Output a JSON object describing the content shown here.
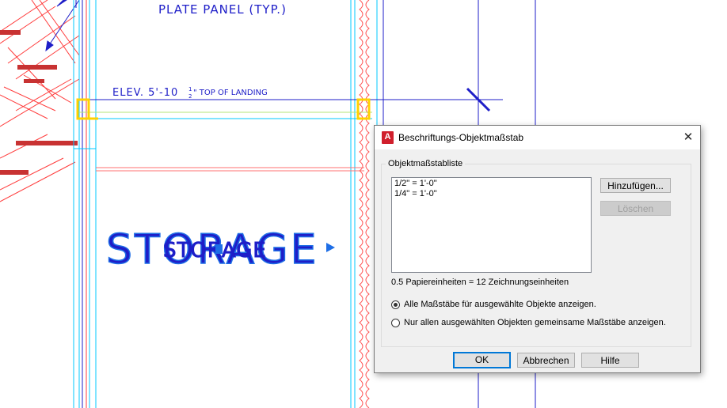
{
  "drawing": {
    "plate_panel_label": "PLATE PANEL (TYP.)",
    "elev_label": "ELEV. 5'-10",
    "elev_fraction_num": "1",
    "elev_fraction_den": "2",
    "elev_suffix": "\" TOP OF LANDING",
    "room_label": "STORAGE",
    "room_label_overlap": "STORAGE"
  },
  "dialog": {
    "title": "Beschriftungs-Objektmaßstab",
    "app_icon_letter": "A",
    "close_glyph": "✕",
    "group_label": "Objektmaßstabliste",
    "scale_list": [
      "1/2\" = 1'-0\"",
      "1/4\" = 1'-0\""
    ],
    "add_button": "Hinzufügen...",
    "delete_button": "Löschen",
    "info_text": "0.5 Papiereinheiten = 12 Zeichnungseinheiten",
    "radio_all": "Alle Maßstäbe für ausgewählte Objekte anzeigen.",
    "radio_common": "Nur allen ausgewählten Objekten gemeinsame Maßstäbe anzeigen.",
    "radio_all_checked": true,
    "ok_button": "OK",
    "cancel_button": "Abbrechen",
    "help_button": "Hilfe"
  }
}
